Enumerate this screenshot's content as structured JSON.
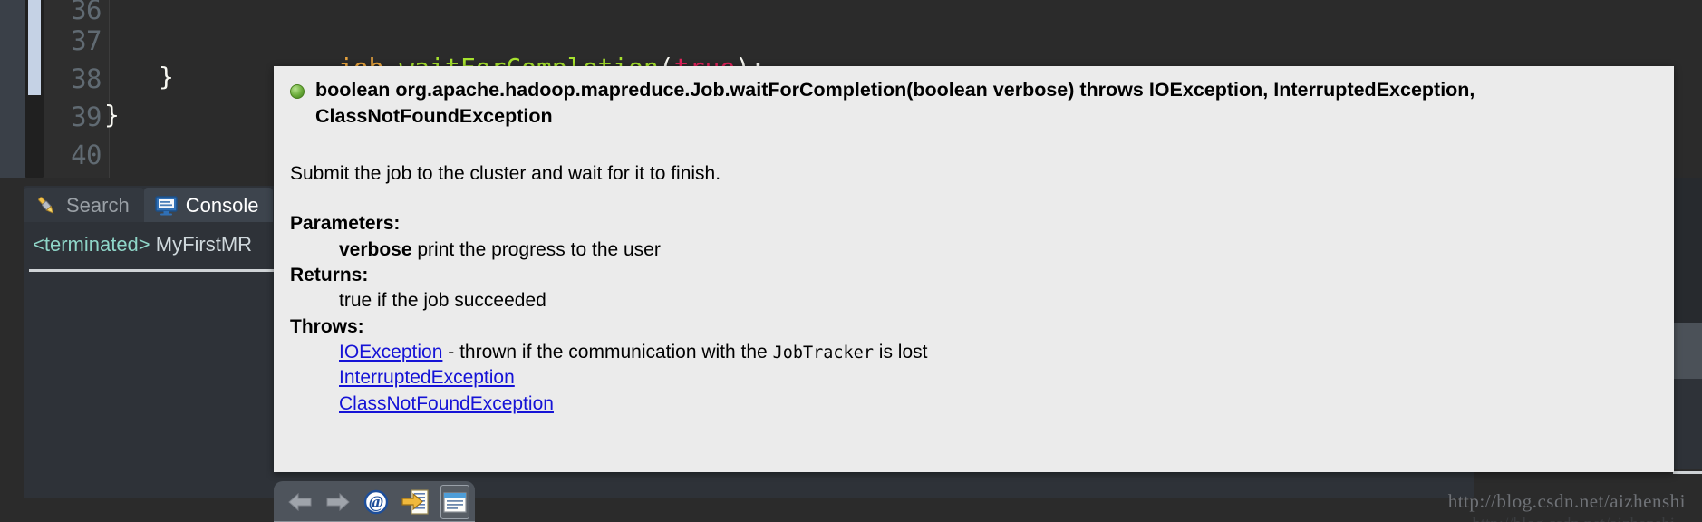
{
  "editor": {
    "line_numbers": [
      "36",
      "37",
      "38",
      "39",
      "40"
    ],
    "lines": [
      {
        "tokens": []
      },
      {
        "tokens": [
          {
            "text": "job",
            "kind": "var"
          },
          {
            "text": ".",
            "kind": "punct"
          },
          {
            "text": "waitForCompletion",
            "kind": "meth"
          },
          {
            "text": "(",
            "kind": "brace"
          },
          {
            "text": "true",
            "kind": "kw"
          },
          {
            "text": ");",
            "kind": "brace"
          }
        ]
      },
      {
        "tokens": [
          {
            "text": "}",
            "kind": "brace"
          }
        ]
      },
      {
        "tokens": [
          {
            "text": "}",
            "kind": "brace"
          }
        ]
      },
      {
        "tokens": []
      }
    ],
    "code_line_37": "job.waitForCompletion(true);",
    "code_line_38": "}",
    "code_line_39": "}"
  },
  "tabs": [
    {
      "label": "Search",
      "icon": "search-icon",
      "active": false
    },
    {
      "label": "Console",
      "icon": "console-icon",
      "active": true
    }
  ],
  "console": {
    "status_prefix": "<terminated>",
    "launch_name": " MyFirstMR"
  },
  "tooltip": {
    "bullet_icon": "green-method-bullet-icon",
    "signature": "boolean org.apache.hadoop.mapreduce.Job.waitForCompletion(boolean verbose) throws IOException, InterruptedException, ClassNotFoundException",
    "description": "Submit the job to the cluster and wait for it to finish.",
    "parameters_label": "Parameters:",
    "param_name": "verbose",
    "param_desc": " print the progress to the user",
    "returns_label": "Returns:",
    "returns_desc": "true if the job succeeded",
    "throws_label": "Throws:",
    "throws": [
      {
        "link": "IOException",
        "desc_before": " - thrown if the communication with the ",
        "code": "JobTracker",
        "desc_after": " is lost"
      },
      {
        "link": "InterruptedException",
        "desc_before": "",
        "code": "",
        "desc_after": ""
      },
      {
        "link": "ClassNotFoundException",
        "desc_before": "",
        "code": "",
        "desc_after": ""
      }
    ]
  },
  "toolbar": {
    "buttons": [
      {
        "name": "back-arrow-icon",
        "title": "Back"
      },
      {
        "name": "forward-arrow-icon",
        "title": "Forward"
      },
      {
        "name": "at-sign-icon",
        "title": "Show Annotations"
      },
      {
        "name": "open-declaration-icon",
        "title": "Open Declaration"
      },
      {
        "name": "open-attached-javadoc-icon",
        "title": "Open Attached Javadoc"
      }
    ]
  },
  "watermark": {
    "url": "http://blog.csdn.net/aizhenshi"
  },
  "colors": {
    "editor_bg": "#2b2b2b",
    "tooltip_bg": "#ebebeb",
    "link": "#1513d6",
    "method_token": "#a6e22e",
    "keyword_token": "#e0205a",
    "var_token": "#e8a33d",
    "terminated_text": "#8fd6c8"
  }
}
